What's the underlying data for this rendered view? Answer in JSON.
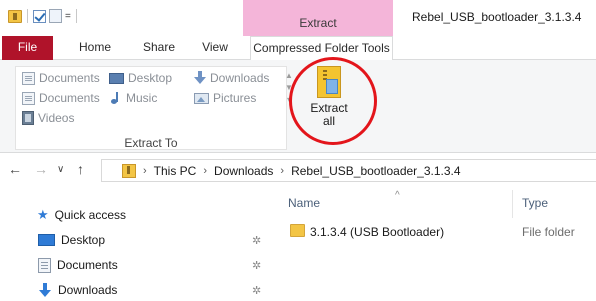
{
  "titlebar": {
    "contextual_tab": "Extract",
    "window_title": "Rebel_USB_bootloader_3.1.3.4",
    "quick_access_dropdown": "="
  },
  "ribbon_tabs": {
    "file": "File",
    "home": "Home",
    "share": "Share",
    "view": "View",
    "compressed": "Compressed Folder Tools"
  },
  "ribbon": {
    "destinations": [
      {
        "label": "Documents",
        "icon": "document-icon"
      },
      {
        "label": "Desktop",
        "icon": "desktop-icon"
      },
      {
        "label": "Downloads",
        "icon": "downloads-icon"
      },
      {
        "label": "Documents",
        "icon": "document-icon"
      },
      {
        "label": "Music",
        "icon": "music-icon"
      },
      {
        "label": "Pictures",
        "icon": "pictures-icon"
      },
      {
        "label": "Videos",
        "icon": "videos-icon"
      }
    ],
    "group_label": "Extract To",
    "extract_all_line1": "Extract",
    "extract_all_line2": "all",
    "highlight_color": "#e3151b"
  },
  "address": {
    "crumbs": [
      "This PC",
      "Downloads",
      "Rebel_USB_bootloader_3.1.3.4"
    ]
  },
  "navpane": {
    "quick_access": "Quick access",
    "items": [
      "Desktop",
      "Documents",
      "Downloads"
    ]
  },
  "filelist": {
    "columns": {
      "name": "Name",
      "type": "Type"
    },
    "rows": [
      {
        "name": "3.1.3.4 (USB Bootloader)",
        "type": "File folder"
      }
    ]
  },
  "colors": {
    "file_tab": "#b0132a",
    "contextual_tab": "#f4b5d9",
    "accent_blue": "#2f7bd6"
  }
}
